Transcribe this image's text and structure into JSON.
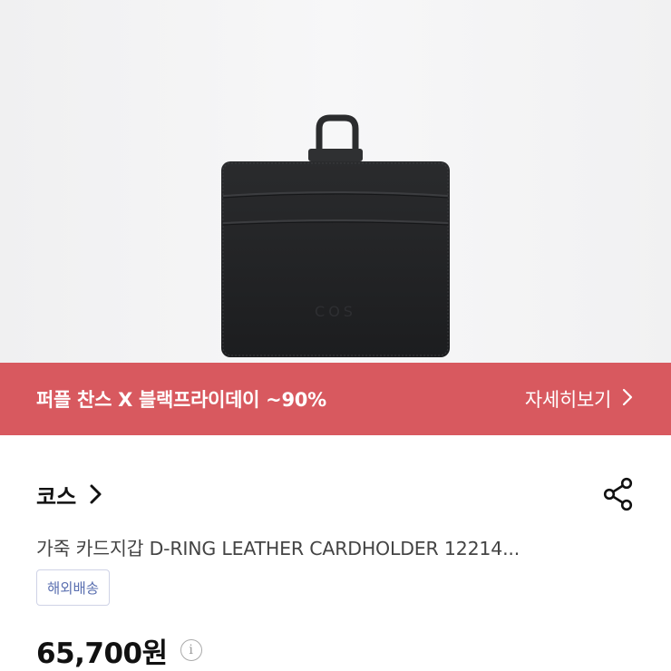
{
  "hero": {
    "image": "black leather card holder with D-ring",
    "logo_text": "COS"
  },
  "promo": {
    "title": "퍼플 찬스 X 블랙프라이데이 ~90%",
    "more_label": "자세히보기",
    "chevron_icon": "chevron-right-icon",
    "background": "#d8595f"
  },
  "brand": {
    "name": "코스",
    "chevron_icon": "chevron-right-icon",
    "share_icon": "share-icon"
  },
  "product": {
    "name": "가죽 카드지갑 D-RING LEATHER CARDHOLDER 12214...",
    "badge": "해외배송",
    "price": "65,700원",
    "info_icon": "info-icon"
  }
}
